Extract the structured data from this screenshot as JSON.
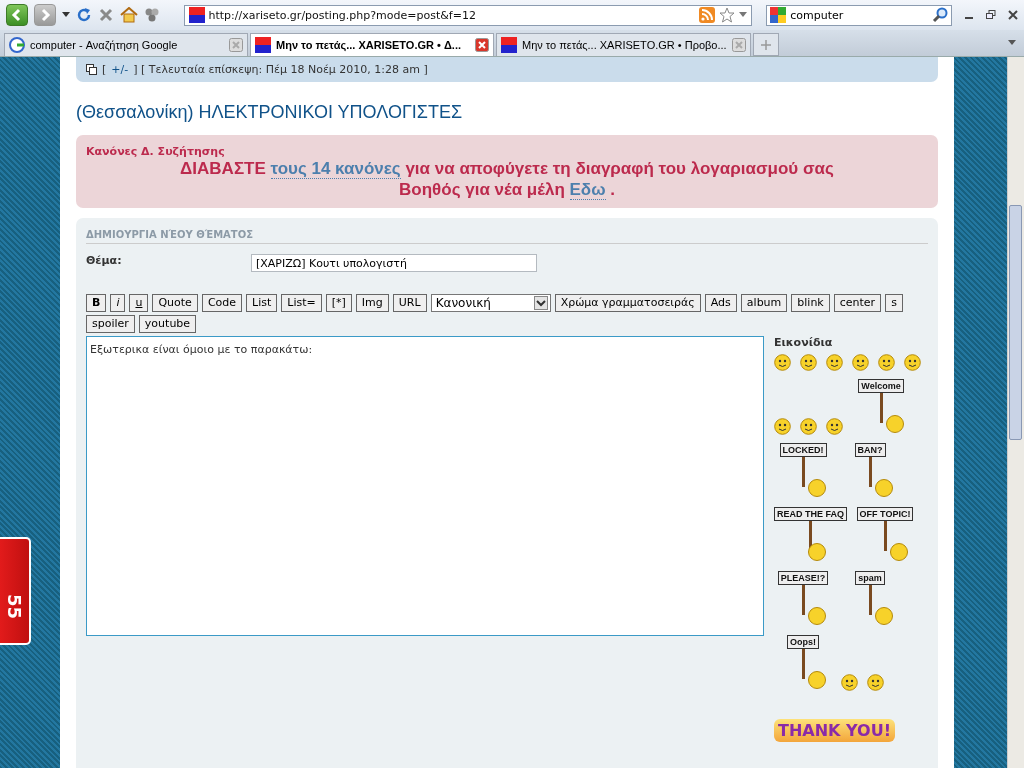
{
  "browser": {
    "url": "http://xariseto.gr/posting.php?mode=post&f=12",
    "search": "computer",
    "tabs": [
      {
        "title": "computer - Αναζήτηση Google",
        "selected": false
      },
      {
        "title": "Μην το πετάς... XARISETO.GR • Δ...",
        "selected": true
      },
      {
        "title": "Μην το πετάς... XARISETO.GR • Προβο...",
        "selected": false
      }
    ]
  },
  "side_badge": "55",
  "visit_bar": {
    "prefix": "[",
    "toggle": "+/-",
    "suffix": "] [ Τελευταία επίσκεψη: Πέμ 18 Νοέμ 2010, 1:28 am ]"
  },
  "forum_title": "(Θεσσαλονίκη) ΗΛΕΚΤΡΟΝΙΚΟΙ ΥΠΟΛΟΓΙΣΤΕΣ",
  "rules": {
    "title": "Κανόνες Δ. Συζήτησης",
    "lines": [
      {
        "before": "ΔΙΑΒΑΣΤΕ ",
        "link": "τους 14 κανόνες",
        "after": " για να αποφύγετε τη διαγραφή του λογαριασμού σας"
      },
      {
        "before": "Βοηθός για νέα μέλη ",
        "link": "Εδω",
        "after": " ."
      }
    ]
  },
  "post": {
    "heading": "ΔΗΜΙΟΥΡΓΙΑ ΝΈΟΥ ΘΈΜΑΤΟΣ",
    "subject_label": "Θέμα:",
    "subject": "[ΧΑΡΙΖΩ] Κουτι υπολογιστή",
    "toolbar": [
      {
        "kind": "button",
        "label": "B"
      },
      {
        "kind": "button",
        "label": "i"
      },
      {
        "kind": "button",
        "label": "u"
      },
      {
        "kind": "button",
        "label": "Quote"
      },
      {
        "kind": "button",
        "label": "Code"
      },
      {
        "kind": "button",
        "label": "List"
      },
      {
        "kind": "button",
        "label": "List="
      },
      {
        "kind": "button",
        "label": "[*]"
      },
      {
        "kind": "button",
        "label": "Img"
      },
      {
        "kind": "button",
        "label": "URL"
      },
      {
        "kind": "select",
        "label": "Κανονική"
      },
      {
        "kind": "button",
        "label": "Χρώμα γραμματοσειράς"
      },
      {
        "kind": "button",
        "label": "Ads"
      },
      {
        "kind": "button",
        "label": "album"
      },
      {
        "kind": "button",
        "label": "blink"
      },
      {
        "kind": "button",
        "label": "center"
      },
      {
        "kind": "button",
        "label": "s"
      },
      {
        "kind": "button",
        "label": "spoiler"
      },
      {
        "kind": "button",
        "label": "youtube"
      }
    ],
    "message": "Εξωτερικα είναι όμοιο με το παρακάτω:",
    "smilies_title": "Εικονίδια",
    "smilies": [
      {
        "kind": "face"
      },
      {
        "kind": "face"
      },
      {
        "kind": "face"
      },
      {
        "kind": "face"
      },
      {
        "kind": "face"
      },
      {
        "kind": "face"
      },
      {
        "kind": "face"
      },
      {
        "kind": "face"
      },
      {
        "kind": "face"
      },
      {
        "kind": "sign",
        "sign": "Welcome"
      },
      {
        "kind": "sign",
        "sign": "LOCKED!"
      },
      {
        "kind": "sign",
        "sign": "BAN?"
      },
      {
        "kind": "sign",
        "sign": "READ THE FAQ"
      },
      {
        "kind": "sign",
        "sign": "OFF TOPIC!"
      },
      {
        "kind": "sign",
        "sign": "PLEASE!?"
      },
      {
        "kind": "sign",
        "sign": "spam"
      },
      {
        "kind": "sign",
        "sign": "Oops!"
      },
      {
        "kind": "face"
      },
      {
        "kind": "face"
      },
      {
        "kind": "banner",
        "sign": "THANK YOU!"
      }
    ]
  }
}
